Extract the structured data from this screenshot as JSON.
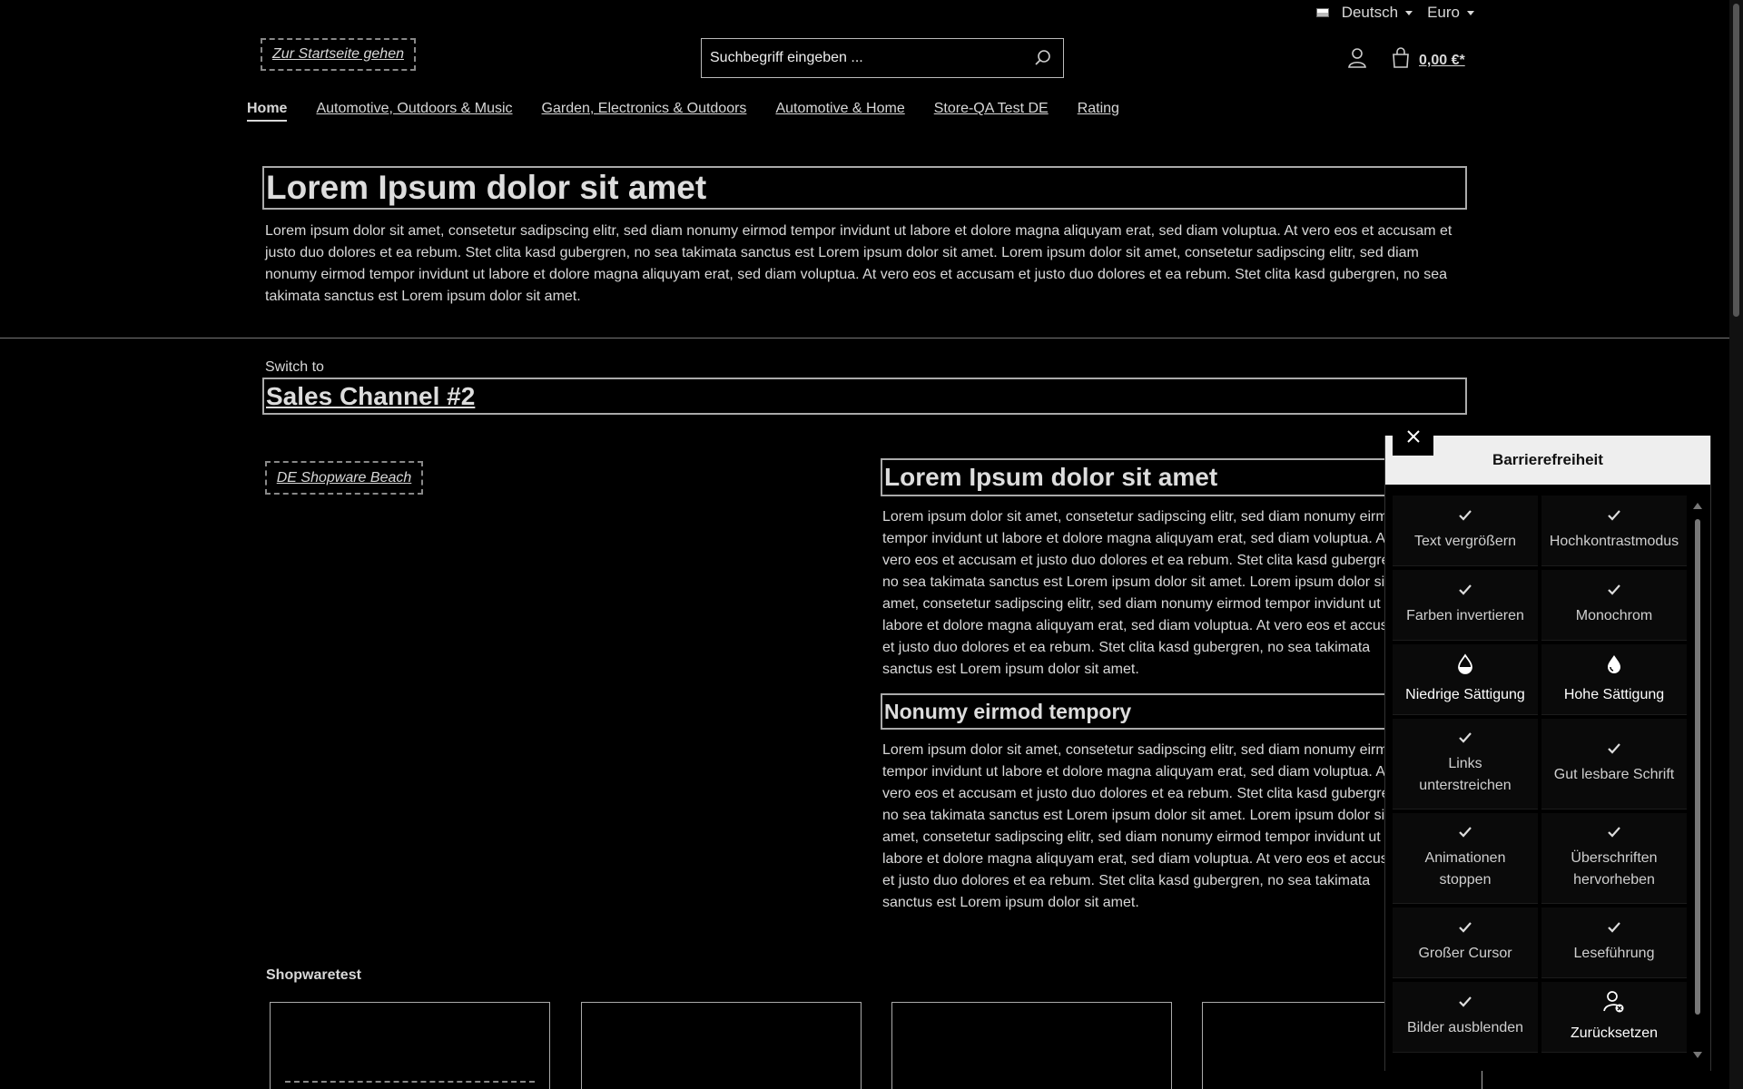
{
  "topbar": {
    "language": "Deutsch",
    "currency": "Euro"
  },
  "header": {
    "home_link": "Zur Startseite gehen",
    "search_placeholder": "Suchbegriff eingeben ...",
    "cart_total": "0,00 €*"
  },
  "nav": {
    "items": [
      {
        "label": "Home"
      },
      {
        "label": "Automotive, Outdoors & Music"
      },
      {
        "label": "Garden, Electronics & Outdoors"
      },
      {
        "label": "Automotive & Home"
      },
      {
        "label": "Store-QA Test DE"
      },
      {
        "label": "Rating"
      }
    ]
  },
  "hero": {
    "title": "Lorem Ipsum dolor sit amet",
    "text": "Lorem ipsum dolor sit amet, consetetur sadipscing elitr, sed diam nonumy eirmod tempor invidunt ut labore et dolore magna aliquyam erat, sed diam voluptua. At vero eos et accusam et justo duo dolores et ea rebum. Stet clita kasd gubergren, no sea takimata sanctus est Lorem ipsum dolor sit amet. Lorem ipsum dolor sit amet, consetetur sadipscing elitr, sed diam nonumy eirmod tempor invidunt ut labore et dolore magna aliquyam erat, sed diam voluptua. At vero eos et accusam et justo duo dolores et ea rebum. Stet clita kasd gubergren, no sea takimata sanctus est Lorem ipsum dolor sit amet."
  },
  "switch": {
    "label": "Switch to",
    "link": "Sales Channel #2"
  },
  "image_link": "DE Shopware Beach",
  "section1": {
    "title": "Lorem Ipsum dolor sit amet",
    "text": "Lorem ipsum dolor sit amet, consetetur sadipscing elitr, sed diam nonumy eirmod tempor invidunt ut labore et dolore magna aliquyam erat, sed diam voluptua. At vero eos et accusam et justo duo dolores et ea rebum. Stet clita kasd gubergren, no sea takimata sanctus est Lorem ipsum dolor sit amet. Lorem ipsum dolor sit amet, consetetur sadipscing elitr, sed diam nonumy eirmod tempor invidunt ut labore et dolore magna aliquyam erat, sed diam voluptua. At vero eos et accusam et justo duo dolores et ea rebum. Stet clita kasd gubergren, no sea takimata sanctus est Lorem ipsum dolor sit amet."
  },
  "section2": {
    "title": "Nonumy eirmod tempory",
    "text": "Lorem ipsum dolor sit amet, consetetur sadipscing elitr, sed diam nonumy eirmod tempor invidunt ut labore et dolore magna aliquyam erat, sed diam voluptua. At vero eos et accusam et justo duo dolores et ea rebum. Stet clita kasd gubergren, no sea takimata sanctus est Lorem ipsum dolor sit amet. Lorem ipsum dolor sit amet, consetetur sadipscing elitr, sed diam nonumy eirmod tempor invidunt ut labore et dolore magna aliquyam erat, sed diam voluptua. At vero eos et accusam et justo duo dolores et ea rebum. Stet clita kasd gubergren, no sea takimata sanctus est Lorem ipsum dolor sit amet."
  },
  "products": {
    "title": "Shopwaretest"
  },
  "a11y": {
    "title": "Barrierefreiheit",
    "options": [
      {
        "label": "Text vergrößern",
        "icon": "check-icon"
      },
      {
        "label": "Hochkontrastmodus",
        "icon": "check-icon"
      },
      {
        "label": "Farben invertieren",
        "icon": "check-icon"
      },
      {
        "label": "Monochrom",
        "icon": "check-icon"
      },
      {
        "label": "Niedrige Sättigung",
        "icon": "droplet-half-icon"
      },
      {
        "label": "Hohe Sättigung",
        "icon": "droplet-full-icon"
      },
      {
        "label": "Links unterstreichen",
        "icon": "check-icon"
      },
      {
        "label": "Gut lesbare Schrift",
        "icon": "check-icon"
      },
      {
        "label": "Animationen stoppen",
        "icon": "check-icon"
      },
      {
        "label": "Überschriften hervorheben",
        "icon": "check-icon"
      },
      {
        "label": "Großer Cursor",
        "icon": "check-icon"
      },
      {
        "label": "Leseführung",
        "icon": "check-icon"
      },
      {
        "label": "Bilder ausblenden",
        "icon": "check-icon"
      },
      {
        "label": "Zurücksetzen",
        "icon": "user-reset-icon"
      }
    ]
  }
}
